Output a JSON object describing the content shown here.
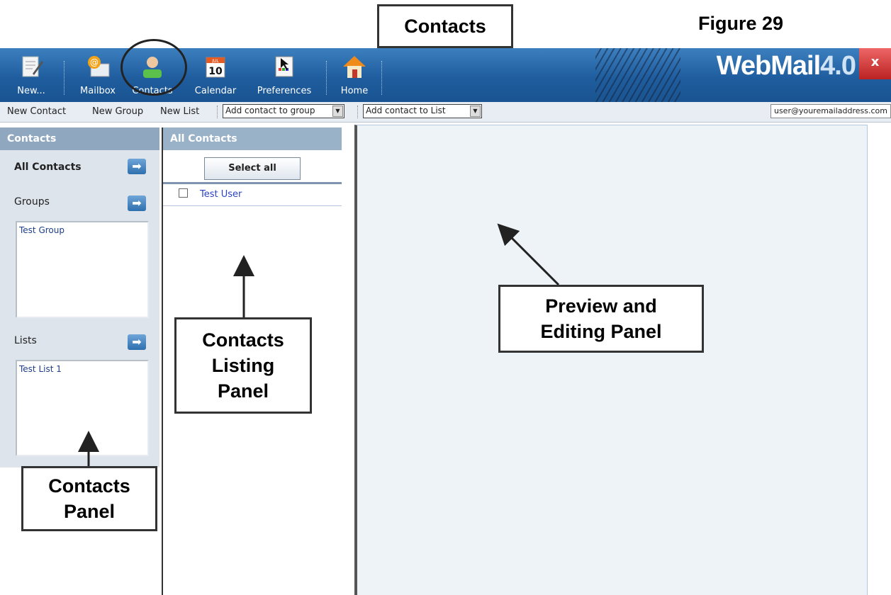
{
  "figure": {
    "title": "Contacts",
    "number": "Figure 29"
  },
  "toolbar": {
    "items": [
      {
        "label": "New...",
        "icon": "new-message-icon"
      },
      {
        "label": "Mailbox",
        "icon": "mailbox-icon"
      },
      {
        "label": "Contacts",
        "icon": "contacts-icon"
      },
      {
        "label": "Calendar",
        "icon": "calendar-icon",
        "day": "10",
        "month": "JUL"
      },
      {
        "label": "Preferences",
        "icon": "preferences-icon"
      },
      {
        "label": "Home",
        "icon": "home-icon"
      }
    ],
    "brand": "WebMail",
    "version": "4.0",
    "close": "x"
  },
  "subbar": {
    "new_contact": "New Contact",
    "new_group": "New Group",
    "new_list": "New List",
    "add_to_group": "Add contact to group",
    "add_to_list": "Add contact to List",
    "user": "user@youremailaddress.com"
  },
  "contacts_panel": {
    "header": "Contacts",
    "all_contacts": "All Contacts",
    "groups": "Groups",
    "group_items": [
      "Test Group"
    ],
    "lists": "Lists",
    "list_items": [
      "Test List 1"
    ]
  },
  "listing_panel": {
    "header": "All Contacts",
    "select_all": "Select all",
    "contacts": [
      "Test User"
    ]
  },
  "callouts": {
    "contacts_panel": "Contacts\nPanel",
    "listing_panel": "Contacts\nListing\nPanel",
    "preview_panel": "Preview and\nEditing Panel"
  },
  "colors": {
    "toolbar": "#1f5d9e",
    "panel_header": "#8fa8c0",
    "contact_link": "#2a42c8"
  }
}
